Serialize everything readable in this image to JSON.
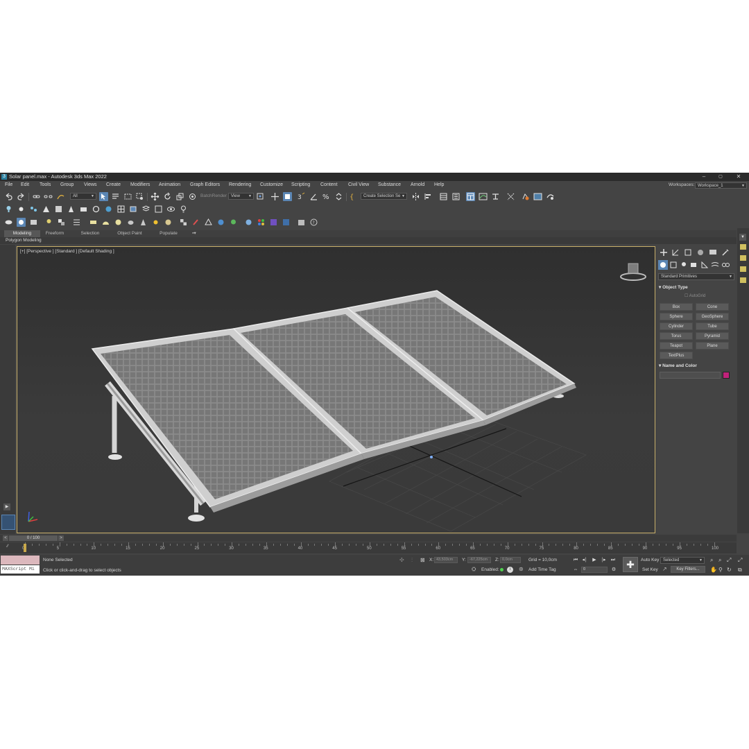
{
  "window": {
    "title": "Solar panel.max - Autodesk 3ds Max 2022",
    "minimize": "–",
    "maximize": "▢",
    "close": "✕"
  },
  "menu": [
    "File",
    "Edit",
    "Tools",
    "Group",
    "Views",
    "Create",
    "Modifiers",
    "Animation",
    "Graph Editors",
    "Rendering",
    "Customize",
    "Scripting",
    "Content",
    "Civil View",
    "Substance",
    "Arnold",
    "Help"
  ],
  "workspace": {
    "label": "Workspaces:",
    "value": "Workspace_1"
  },
  "toolbar": {
    "selection_filter": "All",
    "batch_render": "BatchRender",
    "coord_system": "View",
    "create_selection_set": "Create Selection Se"
  },
  "ribbon": {
    "tabs": [
      "Modeling",
      "Freeform",
      "Selection",
      "Object Paint",
      "Populate"
    ],
    "active_tab": "Modeling",
    "sub_label": "Polygon Modeling"
  },
  "viewport": {
    "label": "[+] [Perspective ] [Standard ] [Default Shading ]"
  },
  "command_panel": {
    "category": "Standard Primitives",
    "object_type_header": "Object Type",
    "autogrid": "AutoGrid",
    "buttons": [
      "Box",
      "Cone",
      "Sphere",
      "GeoSphere",
      "Cylinder",
      "Tube",
      "Torus",
      "Pyramid",
      "Teapot",
      "Plane",
      "TextPlus"
    ],
    "name_color_header": "Name and Color",
    "object_color": "#c0227a"
  },
  "time": {
    "slider_label": "0 / 100",
    "ticks": [
      "0",
      "5",
      "10",
      "15",
      "20",
      "25",
      "30",
      "35",
      "40",
      "45",
      "50",
      "55",
      "60",
      "65",
      "70",
      "75",
      "80",
      "85",
      "90",
      "95",
      "100"
    ]
  },
  "status": {
    "maxscript": "MAXScript Mi",
    "selection": "None Selected",
    "prompt": "Click or click-and-drag to select objects",
    "x_label": "X:",
    "x_value": "43,503cm",
    "y_label": "Y:",
    "y_value": "-67,225cm",
    "z_label": "Z:",
    "z_value": "0,0cm",
    "grid": "Grid = 10,0cm",
    "enabled": "Enabled:",
    "add_time_tag": "Add Time Tag",
    "frame": "0",
    "auto_key": "Auto Key",
    "set_key": "Set Key",
    "key_mode": "Selected",
    "key_filters": "Key Filters..."
  }
}
